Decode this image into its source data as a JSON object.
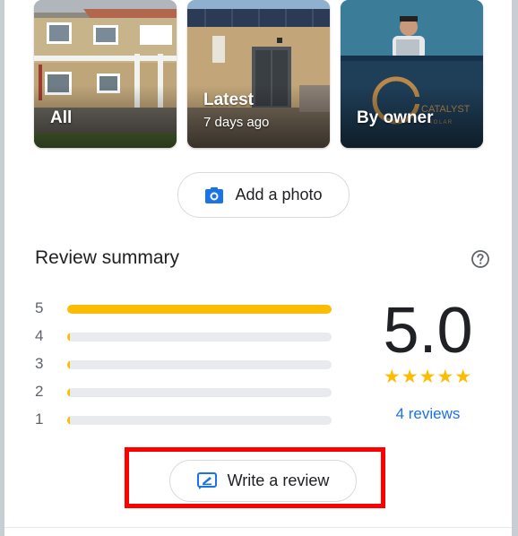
{
  "photos": [
    {
      "title": "All",
      "subtitle": ""
    },
    {
      "title": "Latest",
      "subtitle": "7 days ago"
    },
    {
      "title": "By owner",
      "subtitle": ""
    }
  ],
  "add_photo": {
    "label": "Add a photo",
    "icon": "add-photo-camera-icon"
  },
  "review_summary": {
    "title": "Review summary",
    "help_icon": "help-circle-icon",
    "distribution": [
      {
        "label": "5",
        "fraction": 1.0
      },
      {
        "label": "4",
        "fraction": 0.0
      },
      {
        "label": "3",
        "fraction": 0.0
      },
      {
        "label": "2",
        "fraction": 0.0
      },
      {
        "label": "1",
        "fraction": 0.0
      }
    ],
    "rating": "5.0",
    "stars": "★★★★★",
    "reviews_link": "4 reviews"
  },
  "write_review": {
    "label": "Write a review",
    "icon": "write-review-icon"
  },
  "colors": {
    "accent_blue": "#1a73e8",
    "star_yellow": "#fbbc04",
    "track_gray": "#e8eaed",
    "highlight_red": "#ff0000"
  }
}
